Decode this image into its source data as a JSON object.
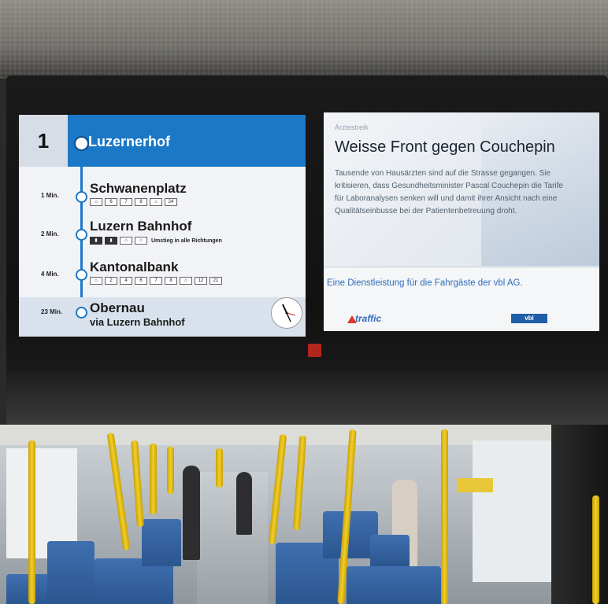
{
  "departure_board": {
    "line_number": "1",
    "terminus": "Luzernerhof",
    "stops": [
      {
        "minutes": "1 Min.",
        "name": "Schwanenplatz",
        "connections": [
          "6",
          "7",
          "8",
          "24"
        ]
      },
      {
        "minutes": "2 Min.",
        "name": "Luzern Bahnhof",
        "connections": [],
        "note": "Umstieg in alle Richtungen"
      },
      {
        "minutes": "4 Min.",
        "name": "Kantonalbank",
        "connections": [
          "2",
          "4",
          "6",
          "7",
          "8",
          "12",
          "21"
        ]
      },
      {
        "minutes": "23 Min.",
        "name": "Obernau",
        "via": "via Luzern Bahnhof"
      }
    ]
  },
  "news_panel": {
    "section": "Ärztestreik",
    "headline": "Weisse Front gegen Couchepin",
    "body": "Tausende von Hausärzten sind auf die Strasse gegangen. Sie kritisieren, dass Gesundheitsminister Pascal Couchepin die Tarife für Laboranalysen senken will und damit ihrer Ansicht nach eine Qualitätseinbusse bei der Patientenbetreuung droht.",
    "service_text": "Eine Dienstleistung für die Fahrgäste der vbl AG.",
    "brand": "traffic",
    "operator_badge": "vbl"
  },
  "colors": {
    "board_blue": "#1b78c6",
    "pole_yellow": "#f2cf25",
    "seat_blue": "#3f6fb0"
  }
}
